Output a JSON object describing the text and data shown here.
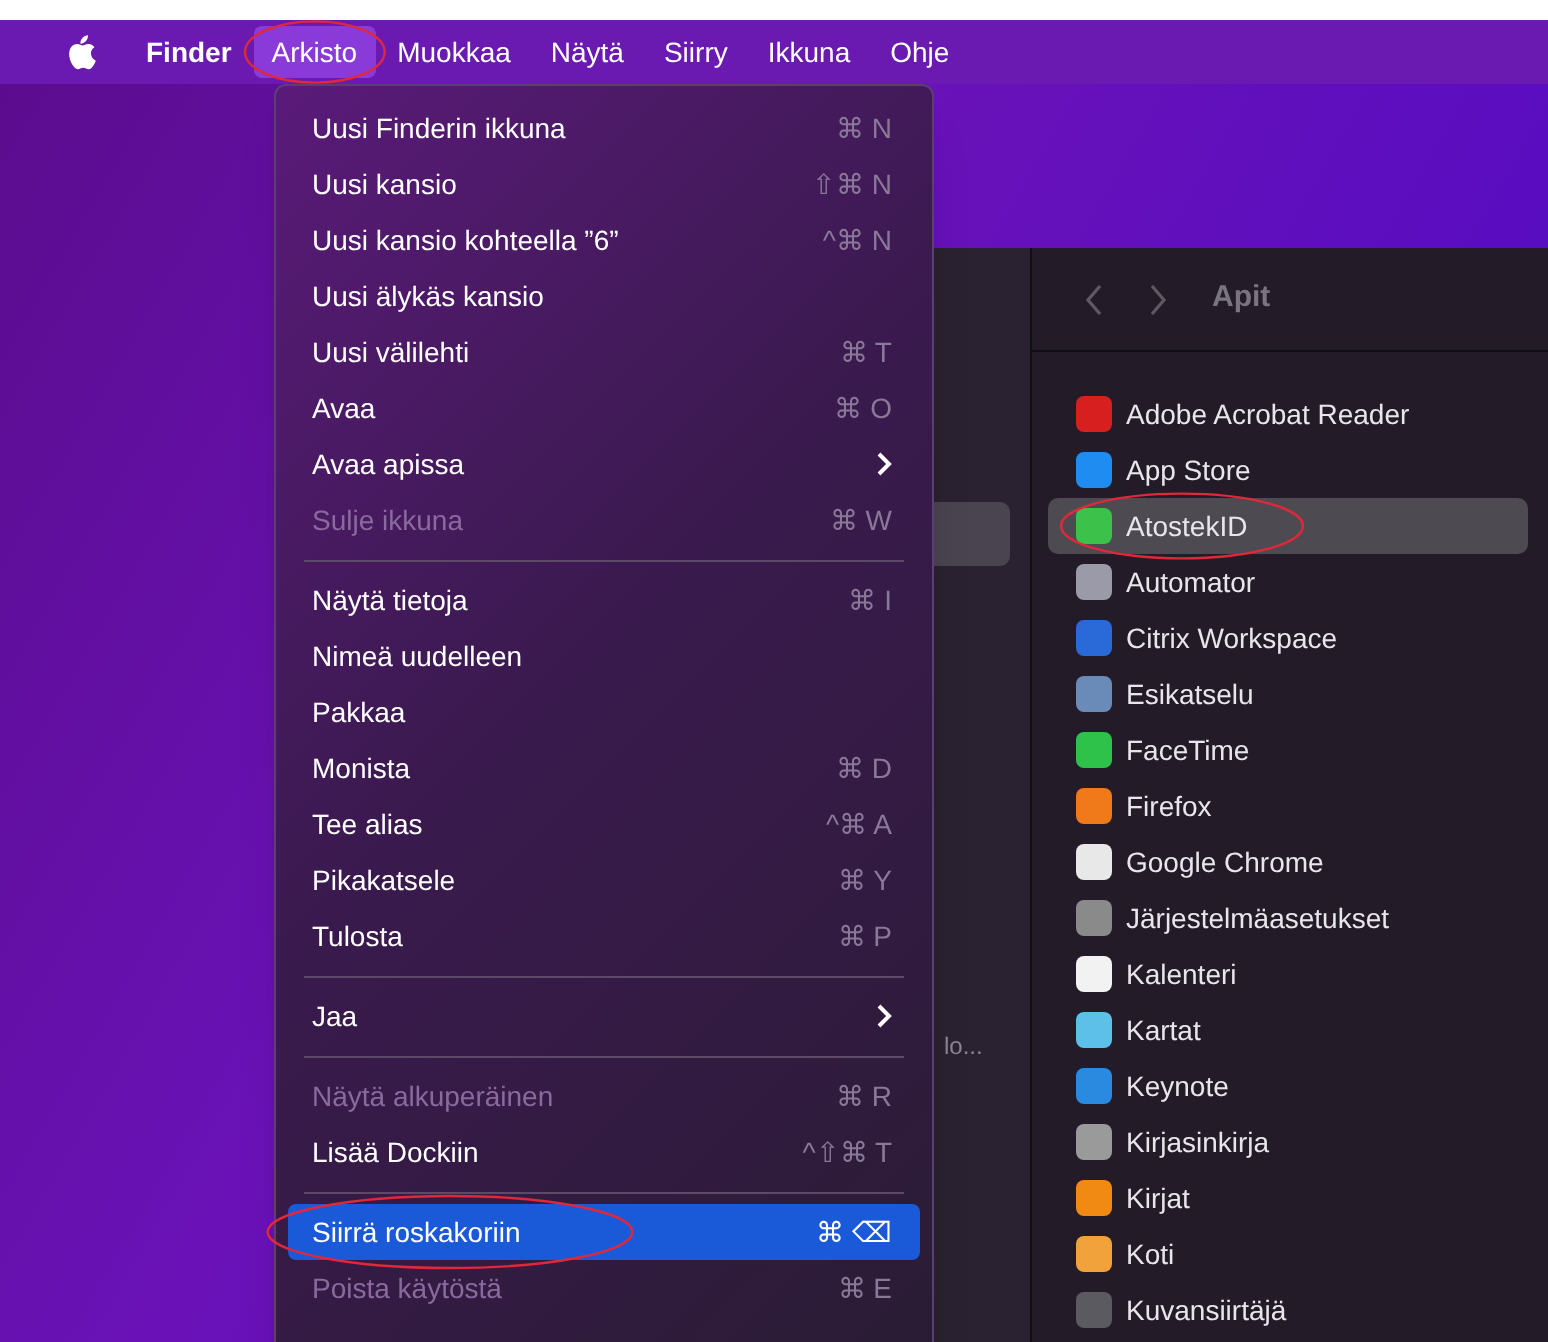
{
  "menu_bar": {
    "items": [
      {
        "label": "Finder",
        "selected": false,
        "circled": false,
        "bold": true
      },
      {
        "label": "Arkisto",
        "selected": true,
        "circled": true,
        "bold": false
      },
      {
        "label": "Muokkaa",
        "selected": false,
        "circled": false,
        "bold": false
      },
      {
        "label": "Näytä",
        "selected": false,
        "circled": false,
        "bold": false
      },
      {
        "label": "Siirry",
        "selected": false,
        "circled": false,
        "bold": false
      },
      {
        "label": "Ikkuna",
        "selected": false,
        "circled": false,
        "bold": false
      },
      {
        "label": "Ohje",
        "selected": false,
        "circled": false,
        "bold": false
      }
    ]
  },
  "file_menu": {
    "items": [
      {
        "kind": "item",
        "label": "Uusi Finderin ikkuna",
        "shortcut": "⌘ N",
        "disabled": false,
        "selected": false,
        "circled": false
      },
      {
        "kind": "item",
        "label": "Uusi kansio",
        "shortcut": "⇧⌘ N",
        "disabled": false,
        "selected": false,
        "circled": false
      },
      {
        "kind": "item",
        "label": "Uusi kansio kohteella ”6”",
        "shortcut": "^⌘ N",
        "disabled": false,
        "selected": false,
        "circled": false
      },
      {
        "kind": "item",
        "label": "Uusi älykäs kansio",
        "disabled": false,
        "selected": false,
        "circled": false
      },
      {
        "kind": "item",
        "label": "Uusi välilehti",
        "shortcut": "⌘ T",
        "disabled": false,
        "selected": false,
        "circled": false
      },
      {
        "kind": "item",
        "label": "Avaa",
        "shortcut": "⌘ O",
        "disabled": false,
        "selected": false,
        "circled": false
      },
      {
        "kind": "submenu",
        "label": "Avaa apissa",
        "disabled": false,
        "selected": false,
        "circled": false
      },
      {
        "kind": "item",
        "label": "Sulje ikkuna",
        "shortcut": "⌘ W",
        "disabled": true,
        "selected": false,
        "circled": false
      },
      {
        "kind": "separator"
      },
      {
        "kind": "item",
        "label": "Näytä tietoja",
        "shortcut": "⌘ I",
        "disabled": false,
        "selected": false,
        "circled": false
      },
      {
        "kind": "item",
        "label": "Nimeä uudelleen",
        "disabled": false,
        "selected": false,
        "circled": false
      },
      {
        "kind": "item",
        "label": "Pakkaa",
        "disabled": false,
        "selected": false,
        "circled": false
      },
      {
        "kind": "item",
        "label": "Monista",
        "shortcut": "⌘ D",
        "disabled": false,
        "selected": false,
        "circled": false
      },
      {
        "kind": "item",
        "label": "Tee alias",
        "shortcut": "^⌘ A",
        "disabled": false,
        "selected": false,
        "circled": false
      },
      {
        "kind": "item",
        "label": "Pikakatsele",
        "shortcut": "⌘ Y",
        "disabled": false,
        "selected": false,
        "circled": false
      },
      {
        "kind": "item",
        "label": "Tulosta",
        "shortcut": "⌘ P",
        "disabled": false,
        "selected": false,
        "circled": false
      },
      {
        "kind": "separator"
      },
      {
        "kind": "submenu",
        "label": "Jaa",
        "disabled": false,
        "selected": false,
        "circled": false
      },
      {
        "kind": "separator"
      },
      {
        "kind": "item",
        "label": "Näytä alkuperäinen",
        "shortcut": "⌘ R",
        "disabled": true,
        "selected": false,
        "circled": false
      },
      {
        "kind": "item",
        "label": "Lisää Dockiin",
        "shortcut": "^⇧⌘ T",
        "disabled": false,
        "selected": false,
        "circled": false
      },
      {
        "kind": "separator"
      },
      {
        "kind": "item",
        "label": "Siirrä roskakoriin",
        "shortcut": "⌘ ⌫",
        "disabled": false,
        "selected": true,
        "circled": true
      },
      {
        "kind": "item",
        "label": "Poista käytöstä",
        "shortcut": "⌘ E",
        "disabled": true,
        "selected": false,
        "circled": false
      }
    ]
  },
  "finder_window": {
    "sidebar_text": "lo...",
    "title": "Apit",
    "apps": [
      {
        "name": "Adobe Acrobat Reader",
        "color": "#d81f1f",
        "selected": false,
        "circled": false
      },
      {
        "name": "App Store",
        "color": "#1e8cf0",
        "selected": false,
        "circled": false
      },
      {
        "name": "AtostekID",
        "color": "#3cc24a",
        "selected": true,
        "circled": true
      },
      {
        "name": "Automator",
        "color": "#9a9aa8",
        "selected": false,
        "circled": false
      },
      {
        "name": "Citrix Workspace",
        "color": "#2a6ad8",
        "selected": false,
        "circled": false
      },
      {
        "name": "Esikatselu",
        "color": "#6a8ab8",
        "selected": false,
        "circled": false
      },
      {
        "name": "FaceTime",
        "color": "#2fc24a",
        "selected": false,
        "circled": false
      },
      {
        "name": "Firefox",
        "color": "#f07a1a",
        "selected": false,
        "circled": false
      },
      {
        "name": "Google Chrome",
        "color": "#e8e8e8",
        "selected": false,
        "circled": false
      },
      {
        "name": "Järjestelmäasetukset",
        "color": "#8a8a8a",
        "selected": false,
        "circled": false
      },
      {
        "name": "Kalenteri",
        "color": "#f2f2f2",
        "selected": false,
        "circled": false
      },
      {
        "name": "Kartat",
        "color": "#5cc0e8",
        "selected": false,
        "circled": false
      },
      {
        "name": "Keynote",
        "color": "#2a8ae0",
        "selected": false,
        "circled": false
      },
      {
        "name": "Kirjasinkirja",
        "color": "#9a9a9a",
        "selected": false,
        "circled": false
      },
      {
        "name": "Kirjat",
        "color": "#f08a12",
        "selected": false,
        "circled": false
      },
      {
        "name": "Koti",
        "color": "#f2a23a",
        "selected": false,
        "circled": false
      },
      {
        "name": "Kuvansiirtäjä",
        "color": "#5a5a60",
        "selected": false,
        "circled": false
      }
    ]
  }
}
